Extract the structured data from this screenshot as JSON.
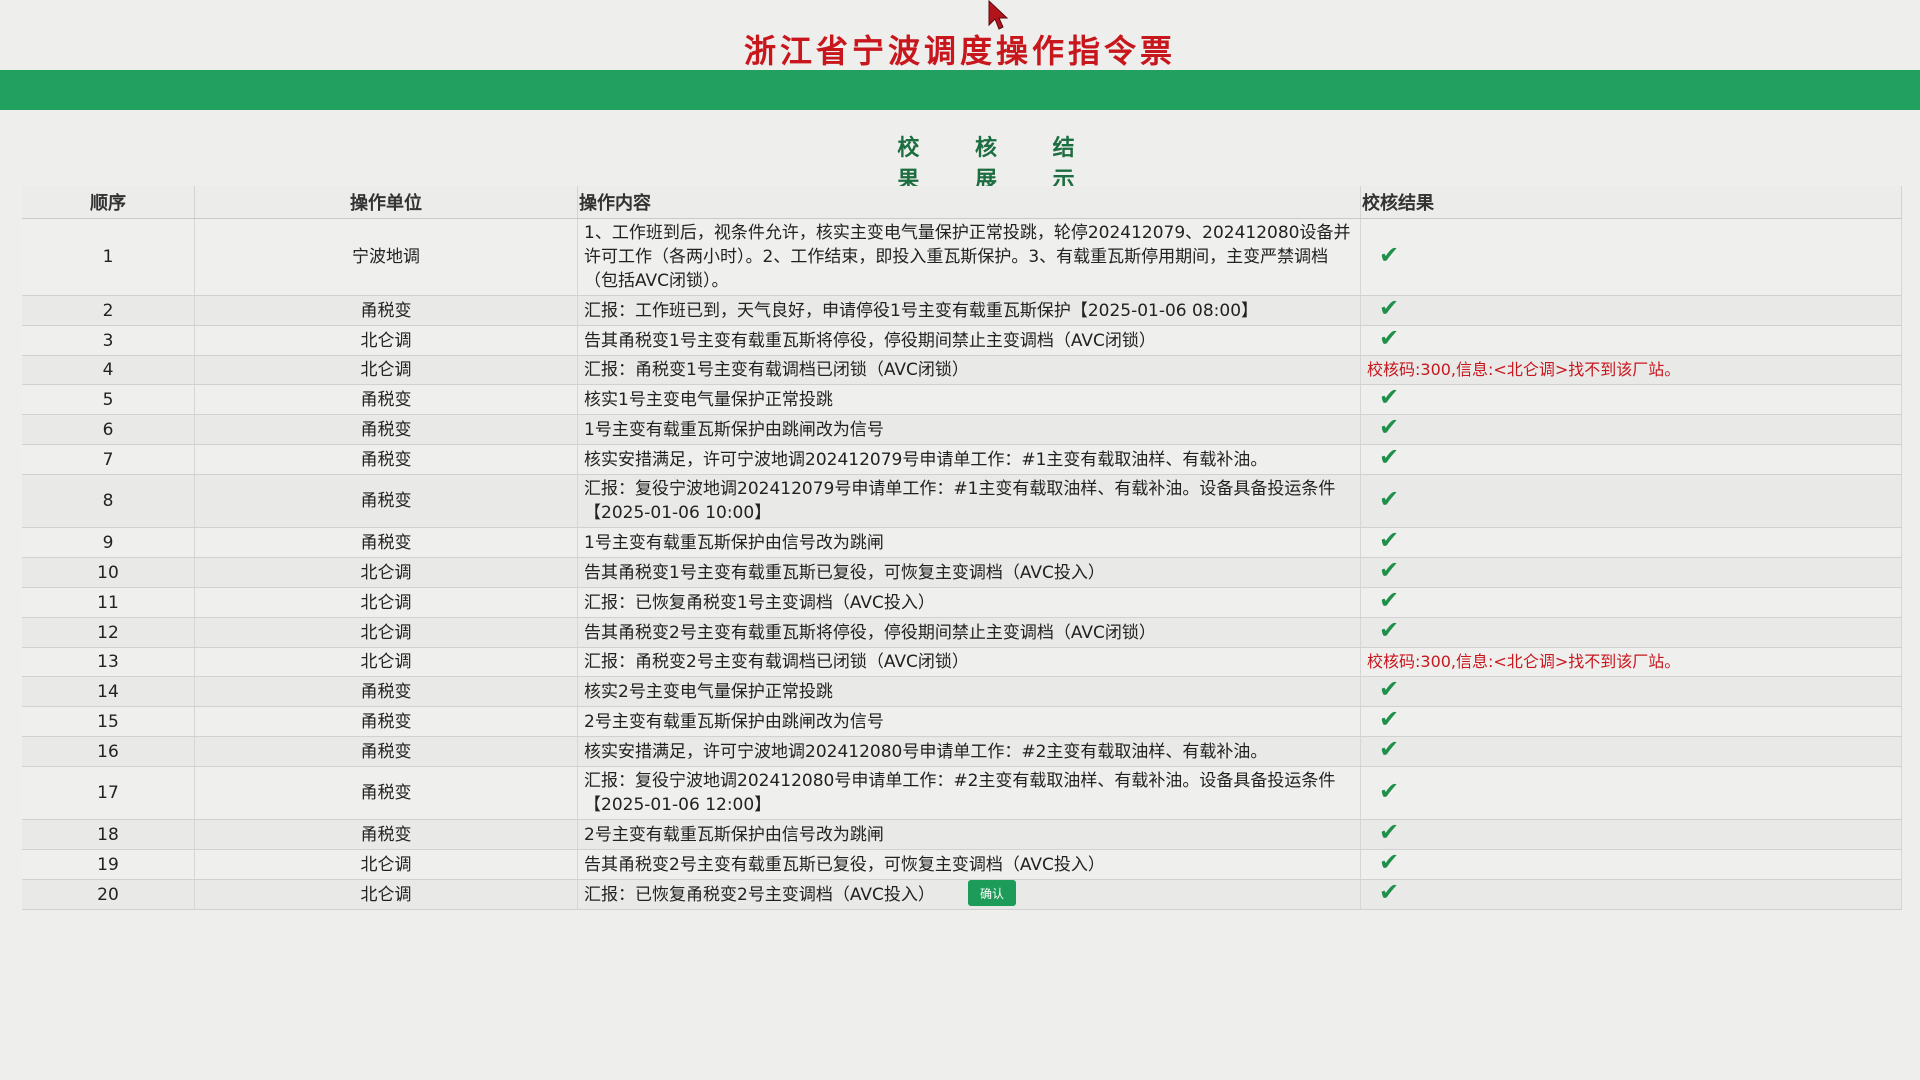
{
  "header": {
    "title": "浙江省宁波调度操作指令票"
  },
  "section": {
    "title": "校 核 结 果 展 示"
  },
  "table": {
    "columns": [
      "顺序",
      "操作单位",
      "操作内容",
      "校核结果"
    ],
    "rows": [
      {
        "seq": "1",
        "unit": "宁波地调",
        "content": "1、工作班到后，视条件允许，核实主变电气量保护正常投跳，轮停202412079、202412080设备并许可工作（各两小时）。2、工作结束，即投入重瓦斯保护。3、有载重瓦斯停用期间，主变严禁调档（包括AVC闭锁）。",
        "result": "✔"
      },
      {
        "seq": "2",
        "unit": "甬税变",
        "content": "汇报：工作班已到，天气良好，申请停役1号主变有载重瓦斯保护【2025-01-06 08:00】",
        "result": "✔"
      },
      {
        "seq": "3",
        "unit": "北仑调",
        "content": "告其甬税变1号主变有载重瓦斯将停役，停役期间禁止主变调档（AVC闭锁）",
        "result": "✔"
      },
      {
        "seq": "4",
        "unit": "北仑调",
        "content": "汇报：甬税变1号主变有载调档已闭锁（AVC闭锁）",
        "result": "校核码:300,信息:<北仑调>找不到该厂站。"
      },
      {
        "seq": "5",
        "unit": "甬税变",
        "content": "核实1号主变电气量保护正常投跳",
        "result": "✔"
      },
      {
        "seq": "6",
        "unit": "甬税变",
        "content": "1号主变有载重瓦斯保护由跳闸改为信号",
        "result": "✔"
      },
      {
        "seq": "7",
        "unit": "甬税变",
        "content": "核实安措满足，许可宁波地调202412079号申请单工作：#1主变有载取油样、有载补油。",
        "result": "✔"
      },
      {
        "seq": "8",
        "unit": "甬税变",
        "content": "汇报：复役宁波地调202412079号申请单工作：#1主变有载取油样、有载补油。设备具备投运条件【2025-01-06 10:00】",
        "result": "✔"
      },
      {
        "seq": "9",
        "unit": "甬税变",
        "content": "1号主变有载重瓦斯保护由信号改为跳闸",
        "result": "✔"
      },
      {
        "seq": "10",
        "unit": "北仑调",
        "content": "告其甬税变1号主变有载重瓦斯已复役，可恢复主变调档（AVC投入）",
        "result": "✔"
      },
      {
        "seq": "11",
        "unit": "北仑调",
        "content": "汇报：已恢复甬税变1号主变调档（AVC投入）",
        "result": "✔"
      },
      {
        "seq": "12",
        "unit": "北仑调",
        "content": "告其甬税变2号主变有载重瓦斯将停役，停役期间禁止主变调档（AVC闭锁）",
        "result": "✔"
      },
      {
        "seq": "13",
        "unit": "北仑调",
        "content": "汇报：甬税变2号主变有载调档已闭锁（AVC闭锁）",
        "result": "校核码:300,信息:<北仑调>找不到该厂站。"
      },
      {
        "seq": "14",
        "unit": "甬税变",
        "content": "核实2号主变电气量保护正常投跳",
        "result": "✔"
      },
      {
        "seq": "15",
        "unit": "甬税变",
        "content": "2号主变有载重瓦斯保护由跳闸改为信号",
        "result": "✔"
      },
      {
        "seq": "16",
        "unit": "甬税变",
        "content": "核实安措满足，许可宁波地调202412080号申请单工作：#2主变有载取油样、有载补油。",
        "result": "✔"
      },
      {
        "seq": "17",
        "unit": "甬税变",
        "content": "汇报：复役宁波地调202412080号申请单工作：#2主变有载取油样、有载补油。设备具备投运条件【2025-01-06 12:00】",
        "result": "✔"
      },
      {
        "seq": "18",
        "unit": "甬税变",
        "content": "2号主变有载重瓦斯保护由信号改为跳闸",
        "result": "✔"
      },
      {
        "seq": "19",
        "unit": "北仑调",
        "content": "告其甬税变2号主变有载重瓦斯已复役，可恢复主变调档（AVC投入）",
        "result": "✔"
      },
      {
        "seq": "20",
        "unit": "北仑调",
        "content": "汇报：已恢复甬税变2号主变调档（AVC投入）",
        "result": "✔"
      }
    ]
  },
  "footer": {
    "confirm_label": "确认"
  },
  "colors": {
    "title_red": "#c8161d",
    "bar_green": "#21a060",
    "check_green": "#1f8f4a",
    "error_red": "#c8161d"
  },
  "icons": {
    "pass": "check-icon",
    "cursor": "mouse-cursor-icon"
  }
}
